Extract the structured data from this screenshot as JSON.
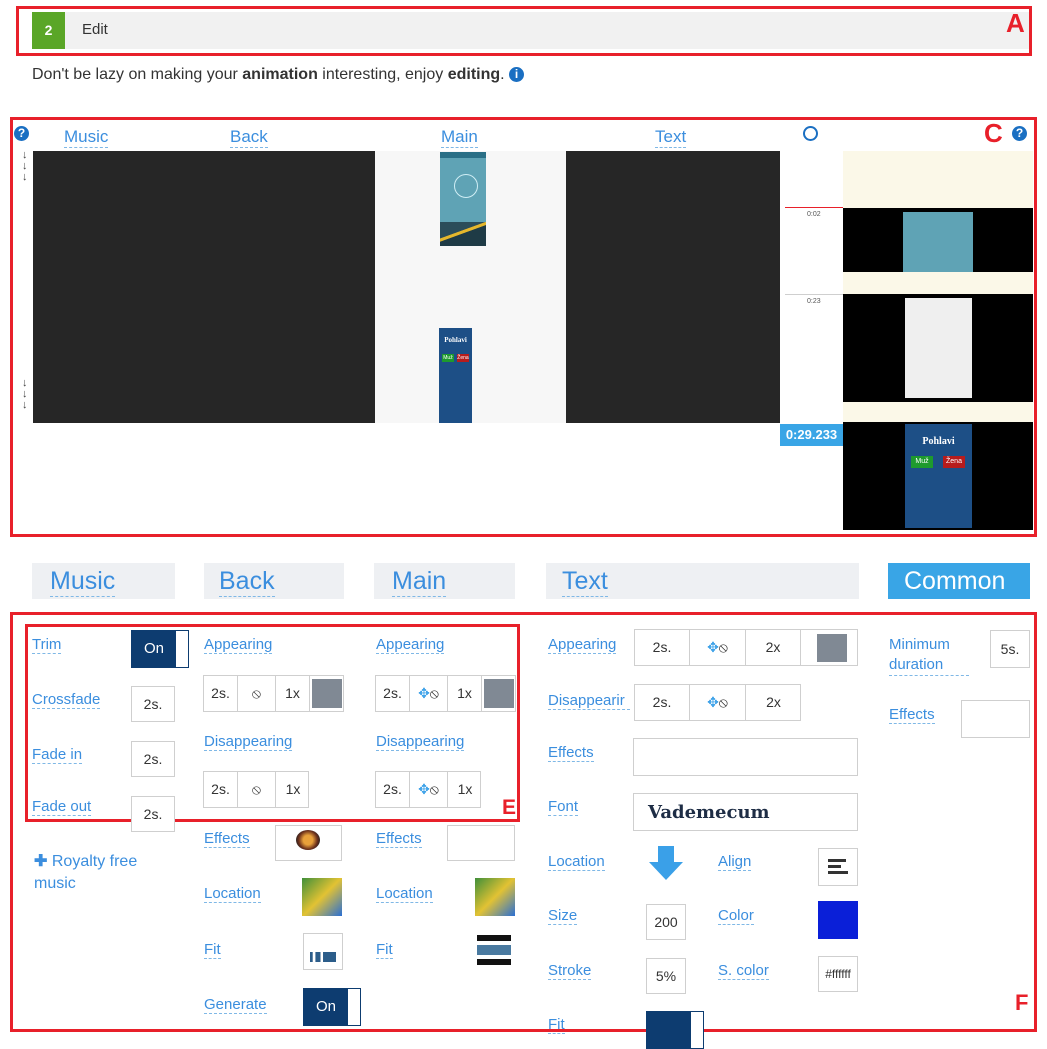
{
  "step": {
    "number": "2",
    "title": "Edit",
    "marker": "A"
  },
  "intro": {
    "pre": "Don't be lazy on making your ",
    "bold1": "animation",
    "mid": " interesting, enjoy ",
    "bold2": "editing",
    "end": "."
  },
  "timeline": {
    "marker": "C",
    "columns": [
      "Music",
      "Back",
      "Main",
      "Text"
    ],
    "phone_screen": {
      "title": "Pohlavi",
      "btn1": "Muž",
      "btn2": "Žena"
    },
    "time_marks": [
      "0:02",
      "0:23"
    ],
    "current_time": "0:29.233"
  },
  "tabs": [
    "Music",
    "Back",
    "Main",
    "Text",
    "Common"
  ],
  "music": {
    "trim_label": "Trim",
    "trim_value": "On",
    "crossfade_label": "Crossfade",
    "crossfade_value": "2s.",
    "fadein_label": "Fade in",
    "fadein_value": "2s.",
    "fadeout_label": "Fade out",
    "fadeout_value": "2s.",
    "royalty_label": "Royalty free music"
  },
  "back": {
    "appearing_label": "Appearing",
    "appearing": [
      "2s.",
      "1x"
    ],
    "disappearing_label": "Disappearing",
    "disappearing": [
      "2s.",
      "1x"
    ],
    "effects_label": "Effects",
    "location_label": "Location",
    "fit_label": "Fit",
    "generate_label": "Generate",
    "generate_value": "On"
  },
  "main": {
    "appearing_label": "Appearing",
    "appearing": [
      "2s.",
      "1x"
    ],
    "disappearing_label": "Disappearing",
    "disappearing": [
      "2s.",
      "1x"
    ],
    "effects_label": "Effects",
    "location_label": "Location",
    "fit_label": "Fit"
  },
  "section_e_marker": "E",
  "text": {
    "appearing_label": "Appearing",
    "appearing": [
      "2s.",
      "2x"
    ],
    "disappearing_label": "Disappearir",
    "disappearing": [
      "2s.",
      "2x"
    ],
    "effects_label": "Effects",
    "font_label": "Font",
    "font_value": "Vademecum",
    "location_label": "Location",
    "align_label": "Align",
    "size_label": "Size",
    "size_value": "200",
    "color_label": "Color",
    "color_value": "#0a1fd8",
    "stroke_label": "Stroke",
    "stroke_value": "5%",
    "scolor_label": "S. color",
    "scolor_value": "#ffffff",
    "fit_label": "Fit"
  },
  "common": {
    "min_duration_label": "Minimum duration",
    "min_duration_value": "5s.",
    "effects_label": "Effects"
  },
  "section_f_marker": "F"
}
